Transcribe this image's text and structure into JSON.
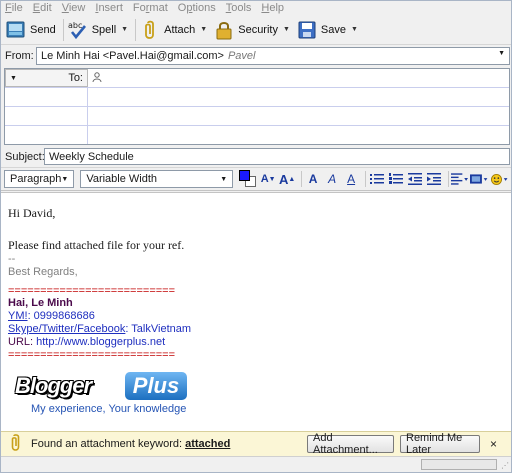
{
  "menu": [
    "File",
    "Edit",
    "View",
    "Insert",
    "Format",
    "Options",
    "Tools",
    "Help"
  ],
  "menu_mnemonics": [
    "F",
    "E",
    "V",
    "I",
    "r",
    "p",
    "T",
    "H"
  ],
  "toolbar": {
    "send": "Send",
    "spell": "Spell",
    "spell_icon_text": "abc",
    "attach": "Attach",
    "security": "Security",
    "save": "Save"
  },
  "from": {
    "label": "From:",
    "value": "Le Minh Hai <Pavel.Hai@gmail.com>",
    "identity": "Pavel"
  },
  "recipients": {
    "type": "To:",
    "rows": 4
  },
  "subject": {
    "label": "Subject:",
    "value": "Weekly Schedule"
  },
  "format": {
    "paragraph": "Paragraph",
    "font": "Variable Width",
    "text_color": "#1a1aff",
    "bg_color": "#ffffff",
    "btn_smaller": "A",
    "btn_larger": "A",
    "btn_bold": "A",
    "btn_italic": "A",
    "btn_underline": "A"
  },
  "body": {
    "greeting": "Hi David,",
    "message": "Please find attached file for your ref.",
    "sig_sep": "--",
    "regards": "Best Regards,",
    "rule1": "==========================",
    "name": "Hai, Le Minh",
    "ym_label": "YM!",
    "ym_value": ": 0999868686",
    "skype_label": "Skype/Twitter/Facebook",
    "skype_value": ": TalkVietnam",
    "url_label": "URL: ",
    "url_value": "http://www.bloggerplus.net",
    "rule2": "==========================",
    "logo_word": "Blogger",
    "logo_plus": "Plus",
    "logo_tag": "My experience, Your knowledge"
  },
  "notification": {
    "message": "Found an attachment keyword: ",
    "keyword": "attached",
    "add_button": "Add Attachment...",
    "remind_button": "Remind Me Later",
    "close": "×"
  }
}
